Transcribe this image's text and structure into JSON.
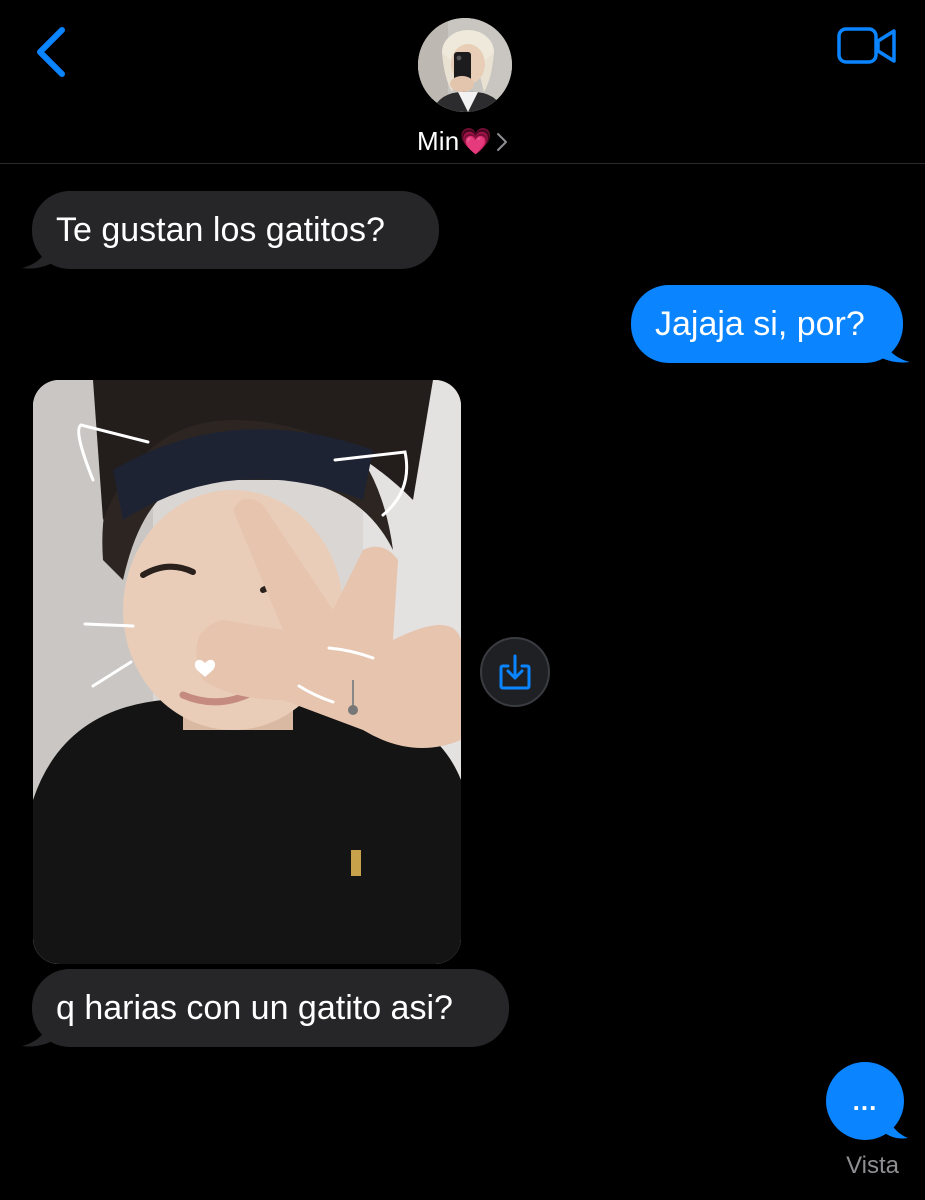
{
  "header": {
    "contact_name": "Min",
    "contact_emoji": "💗",
    "back_icon": "chevron-left-icon",
    "video_icon": "video-camera-icon"
  },
  "messages": [
    {
      "direction": "incoming",
      "type": "text",
      "text": "Te gustan los gatitos?"
    },
    {
      "direction": "outgoing",
      "type": "text",
      "text": "Jajaja si, por?"
    },
    {
      "direction": "incoming",
      "type": "image",
      "description_icon": "photo-attachment"
    },
    {
      "direction": "incoming",
      "type": "text",
      "text": "q harias con un gatito asi?"
    }
  ],
  "typing_indicator": {
    "text": "..."
  },
  "read_receipt": "Vista",
  "colors": {
    "background": "#000000",
    "incoming_bubble": "#262628",
    "outgoing_bubble": "#0a84ff",
    "accent": "#0a84ff",
    "secondary_text": "#8e8e93"
  }
}
